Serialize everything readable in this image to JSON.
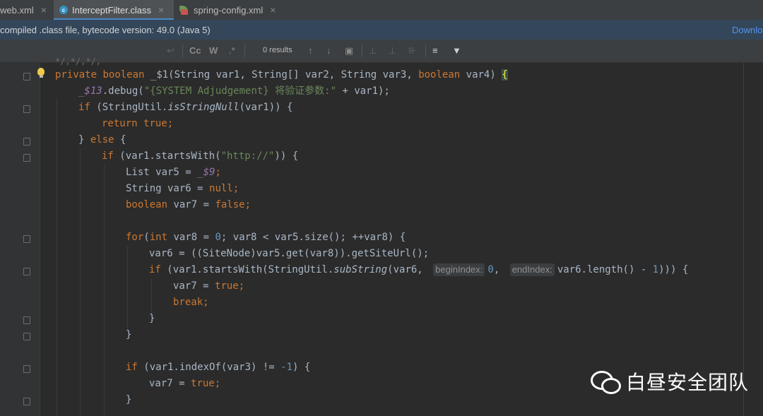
{
  "tabs": [
    {
      "label": "web.xml"
    },
    {
      "label": "InterceptFilter.class"
    },
    {
      "label": "spring-config.xml"
    }
  ],
  "tab_close": "×",
  "banner": {
    "text": "compiled .class file, bytecode version: 49.0 (Java 5)",
    "link": "Downlo"
  },
  "find": {
    "results": "0 results",
    "icons": [
      "wrap-icon",
      "match-case-icon",
      "words-icon",
      "regex-icon",
      "previous-occurrence-icon",
      "next-occurrence-icon",
      "select-all-icon",
      "add-selection-icon",
      "remove-selection-icon",
      "select-all-occurrences-icon",
      "multiline-icon",
      "filter-icon"
    ],
    "labels": {
      "wrap": "↩",
      "match_case": "Cc",
      "words": "W",
      "regex": ".*",
      "prev": "↑",
      "next": "↓",
      "multiline": "≡",
      "filter": "▼"
    }
  },
  "editor": {
    "partial_top": "*/,*/,*/,",
    "code": {
      "l1": {
        "kw1": "private",
        "kw2": "boolean",
        "name": " _$1(String var1, String[] var2, String var3, ",
        "kw3": "boolean",
        "tail": " var4) ",
        "brace": "{"
      },
      "l2": {
        "field": "_$13",
        "call": ".debug(",
        "str": "\"{SYSTEM Adjudgement} 将验证参数:\"",
        "tail": " + var1);"
      },
      "l3": {
        "kw": "if",
        "pre": " (StringUtil.",
        "method": "isStringNull",
        "tail": "(var1)) {"
      },
      "l4": {
        "kw1": "return",
        "kw2": "true",
        "semi": ";"
      },
      "l5": {
        "pre": "} ",
        "kw": "else",
        "tail": " {"
      },
      "l6": {
        "kw": "if",
        "pre": " (var1.startsWith(",
        "str": "\"http://\"",
        "tail": ")) {"
      },
      "l7": {
        "pre": "List var5 = ",
        "field": "_$9",
        "semi": ";"
      },
      "l8": {
        "pre": "String var6 = ",
        "kw": "null",
        "semi": ";"
      },
      "l9": {
        "kw": "boolean",
        "pre": " var7 = ",
        "kw2": "false",
        "semi": ";"
      },
      "l10": {
        "kw": "for",
        "p1": "(",
        "kw2": "int",
        "p2": " var8 = ",
        "num": "0",
        "p3": "; var8 < var5.size(); ++var8) {"
      },
      "l11": {
        "text": "var6 = ((SiteNode)var5.get(var8)).getSiteUrl();"
      },
      "l12": {
        "kw": "if",
        "p1": " (var1.startsWith(StringUtil.",
        "method": "subString",
        "p2": "(var6, ",
        "hint1": "beginIndex:",
        "num1": "0",
        "p3": ", ",
        "hint2": "endIndex:",
        "p4": "var6.length() - ",
        "num2": "1",
        "p5": "))) {"
      },
      "l13": {
        "pre": "var7 = ",
        "kw": "true",
        "semi": ";"
      },
      "l14": {
        "kw": "break",
        "semi": ";"
      },
      "l15": {
        "text": "}"
      },
      "l16": {
        "text": "}"
      },
      "l17": {
        "kw": "if",
        "pre": " (var1.indexOf(var3) != ",
        "num": "-1",
        "tail": ") {"
      },
      "l18": {
        "pre": "var7 = ",
        "kw": "true",
        "semi": ";"
      },
      "l19": {
        "text": "}"
      }
    }
  },
  "watermark": {
    "text": "白昼安全团队"
  },
  "colors": {
    "keyword": "#cc7832",
    "string": "#6a8759",
    "number": "#6897bb",
    "field": "#9876aa",
    "text": "#a9b7c6",
    "background": "#2b2b2b",
    "link": "#5394ec"
  }
}
